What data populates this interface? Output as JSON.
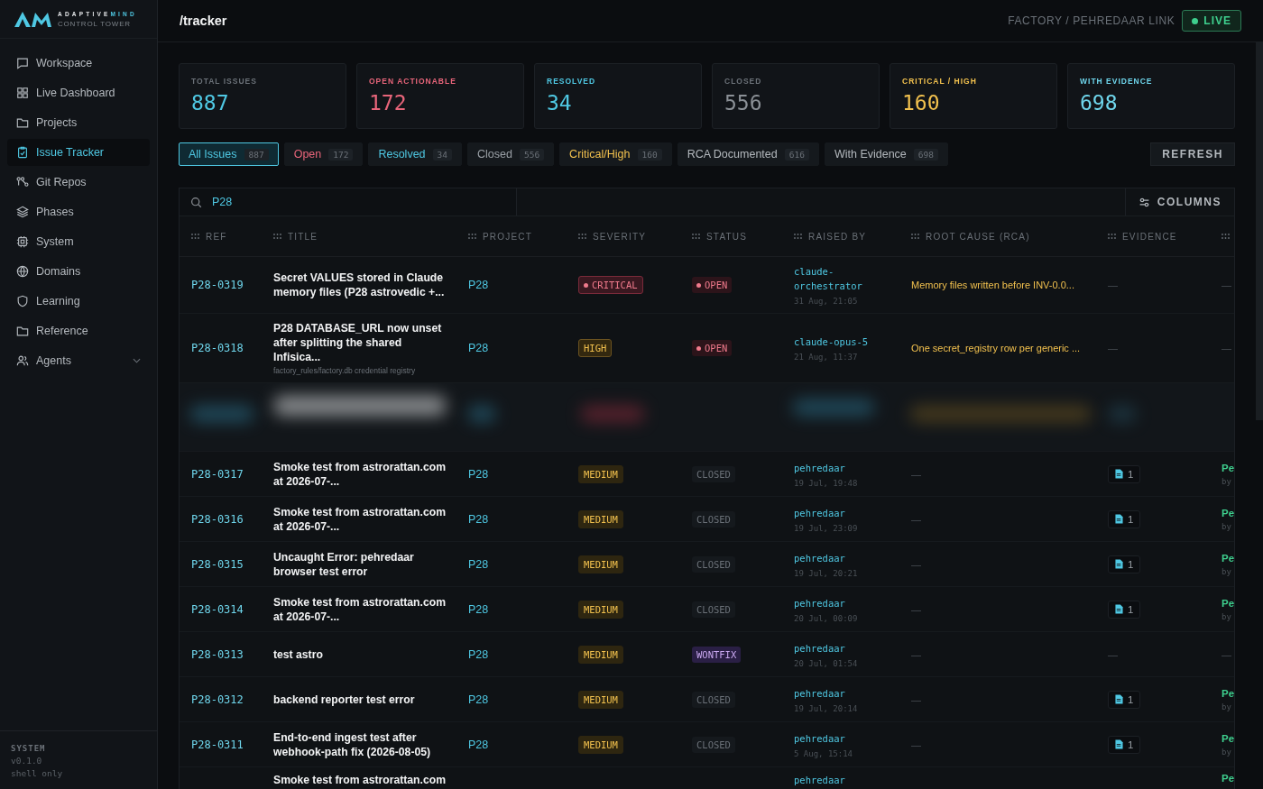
{
  "brand": {
    "name_main": "ADAPTIVE",
    "name_accent": "MIND",
    "tagline": "CONTROL TOWER"
  },
  "sidebar": {
    "items": [
      {
        "label": "Workspace",
        "selected": false,
        "kind": "link"
      },
      {
        "label": "Live Dashboard",
        "selected": false,
        "kind": "link"
      },
      {
        "label": "Projects",
        "selected": false,
        "kind": "link"
      },
      {
        "label": "Issue Tracker",
        "selected": true,
        "kind": "link"
      },
      {
        "label": "Git Repos",
        "selected": false,
        "kind": "link"
      },
      {
        "label": "Phases",
        "selected": false,
        "kind": "link"
      },
      {
        "label": "System",
        "selected": false,
        "kind": "link"
      },
      {
        "label": "Domains",
        "selected": false,
        "kind": "link"
      },
      {
        "label": "Learning",
        "selected": false,
        "kind": "link"
      },
      {
        "label": "Reference",
        "selected": false,
        "kind": "link"
      },
      {
        "label": "Agents",
        "selected": false,
        "kind": "group"
      }
    ],
    "footer": {
      "heading": "SYSTEM",
      "version": "v0.1.0",
      "mode": "shell only"
    }
  },
  "header": {
    "path": "/tracker",
    "breadcrumb": "FACTORY / PEHREDAAR LINK",
    "live": "LIVE"
  },
  "stats": [
    {
      "label": "TOTAL ISSUES",
      "value": "887",
      "label_muted": true,
      "color": "#4fc8e3"
    },
    {
      "label": "OPEN ACTIONABLE",
      "value": "172",
      "label_muted": false,
      "color": "#e8657a"
    },
    {
      "label": "RESOLVED",
      "value": "34",
      "label_muted": false,
      "color": "#4fc8e3"
    },
    {
      "label": "CLOSED",
      "value": "556",
      "label_muted": true,
      "color": "#8b9096"
    },
    {
      "label": "CRITICAL / HIGH",
      "value": "160",
      "label_muted": false,
      "color": "#f2c14e"
    },
    {
      "label": "WITH EVIDENCE",
      "value": "698",
      "label_muted": false,
      "color": "#6fd6ec"
    }
  ],
  "filters": [
    {
      "label": "All Issues",
      "count": "887",
      "selected": true,
      "color": "#4fc8e3"
    },
    {
      "label": "Open",
      "count": "172",
      "selected": false,
      "color": "#e8657a"
    },
    {
      "label": "Resolved",
      "count": "34",
      "selected": false,
      "color": "#4fc8e3"
    },
    {
      "label": "Closed",
      "count": "556",
      "selected": false,
      "color": "#9aa0a6"
    },
    {
      "label": "Critical/High",
      "count": "160",
      "selected": false,
      "color": "#f2c14e"
    },
    {
      "label": "RCA Documented",
      "count": "616",
      "selected": false,
      "color": "#b4b9be"
    },
    {
      "label": "With Evidence",
      "count": "698",
      "selected": false,
      "color": "#b4b9be"
    }
  ],
  "refresh": "REFRESH",
  "search": {
    "value": "P28"
  },
  "columns_button": "COLUMNS",
  "table": {
    "columns": [
      "REF",
      "TITLE",
      "PROJECT",
      "SEVERITY",
      "STATUS",
      "RAISED BY",
      "ROOT CAUSE (RCA)",
      "EVIDENCE"
    ],
    "rows": [
      {
        "kind": "issue",
        "ref": "P28-0319",
        "title": "Secret VALUES stored in Claude memory files (P28 astrovedic +...",
        "project": "P28",
        "severity": {
          "label": "CRITICAL",
          "kind": "critical"
        },
        "status": {
          "label": "OPEN",
          "kind": "open"
        },
        "raised_by": "claude-orchestrator",
        "raised_at": "31 Aug, 21:05",
        "rca": "Memory files written before INV-0.0...",
        "evidence": "—",
        "last": "—"
      },
      {
        "kind": "issue",
        "ref": "P28-0318",
        "title": "P28 DATABASE_URL now unset after splitting the shared Infisica...",
        "subtitle": "factory_rules/factory.db credential registry",
        "project": "P28",
        "severity": {
          "label": "HIGH",
          "kind": "high"
        },
        "status": {
          "label": "OPEN",
          "kind": "open"
        },
        "raised_by": "claude-opus-5",
        "raised_at": "21 Aug, 11:37",
        "rca": "One secret_registry row per generic ...",
        "evidence": "—",
        "last": "—"
      },
      {
        "kind": "blurred"
      },
      {
        "kind": "issue",
        "ref": "P28-0317",
        "title": "Smoke test from astrorattan.com at 2026-07-...",
        "project": "P28",
        "severity": {
          "label": "MEDIUM",
          "kind": "medium"
        },
        "status": {
          "label": "CLOSED",
          "kind": "closed"
        },
        "raised_by": "pehredaar",
        "raised_at": "19 Jul, 19:48",
        "rca": "—",
        "evidence_count": "1",
        "last": "Pe",
        "last_sub": "by"
      },
      {
        "kind": "issue",
        "ref": "P28-0316",
        "title": "Smoke test from astrorattan.com at 2026-07-...",
        "project": "P28",
        "severity": {
          "label": "MEDIUM",
          "kind": "medium"
        },
        "status": {
          "label": "CLOSED",
          "kind": "closed"
        },
        "raised_by": "pehredaar",
        "raised_at": "19 Jul, 23:09",
        "rca": "—",
        "evidence_count": "1",
        "last": "Pe",
        "last_sub": "by"
      },
      {
        "kind": "issue",
        "ref": "P28-0315",
        "title": "Uncaught Error: pehredaar browser test error",
        "project": "P28",
        "severity": {
          "label": "MEDIUM",
          "kind": "medium"
        },
        "status": {
          "label": "CLOSED",
          "kind": "closed"
        },
        "raised_by": "pehredaar",
        "raised_at": "19 Jul, 20:21",
        "rca": "—",
        "evidence_count": "1",
        "last": "Pe",
        "last_sub": "by"
      },
      {
        "kind": "issue",
        "ref": "P28-0314",
        "title": "Smoke test from astrorattan.com at 2026-07-...",
        "project": "P28",
        "severity": {
          "label": "MEDIUM",
          "kind": "medium"
        },
        "status": {
          "label": "CLOSED",
          "kind": "closed"
        },
        "raised_by": "pehredaar",
        "raised_at": "20 Jul, 00:09",
        "rca": "—",
        "evidence_count": "1",
        "last": "Pe",
        "last_sub": "by"
      },
      {
        "kind": "issue",
        "ref": "P28-0313",
        "title": "test astro",
        "project": "P28",
        "severity": {
          "label": "MEDIUM",
          "kind": "medium"
        },
        "status": {
          "label": "WONTFIX",
          "kind": "wontfix"
        },
        "raised_by": "pehredaar",
        "raised_at": "20 Jul, 01:54",
        "rca": "—",
        "evidence": "—",
        "last": "—"
      },
      {
        "kind": "issue",
        "ref": "P28-0312",
        "title": "backend reporter test error",
        "project": "P28",
        "severity": {
          "label": "MEDIUM",
          "kind": "medium"
        },
        "status": {
          "label": "CLOSED",
          "kind": "closed"
        },
        "raised_by": "pehredaar",
        "raised_at": "19 Jul, 20:14",
        "rca": "—",
        "evidence_count": "1",
        "last": "Pe",
        "last_sub": "by"
      },
      {
        "kind": "issue",
        "ref": "P28-0311",
        "title": "End-to-end ingest test after webhook-path fix (2026-08-05)",
        "project": "P28",
        "severity": {
          "label": "MEDIUM",
          "kind": "medium"
        },
        "status": {
          "label": "CLOSED",
          "kind": "closed"
        },
        "raised_by": "pehredaar",
        "raised_at": "5 Aug, 15:14",
        "rca": "—",
        "evidence_count": "1",
        "last": "Pe",
        "last_sub": "by"
      },
      {
        "kind": "issue",
        "title": "Smoke test from astrorattan.com",
        "raised_by": "pehredaar",
        "last": "Pe"
      }
    ]
  }
}
